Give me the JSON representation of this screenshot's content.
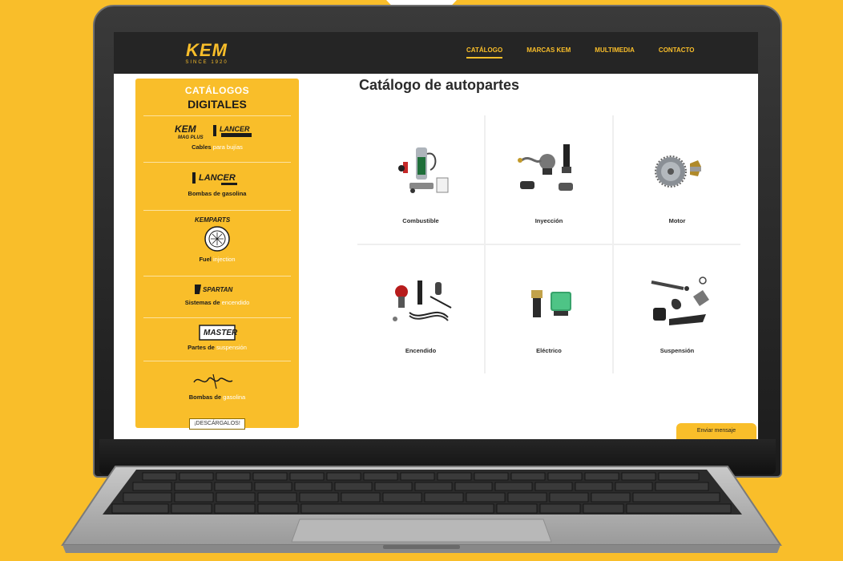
{
  "nav": {
    "logo_word": "KEM",
    "logo_sub": "SINCE 1920",
    "links": [
      {
        "label": "CATÁLOGO"
      },
      {
        "label": "MARCAS KEM"
      },
      {
        "label": "MULTIMEDIA"
      },
      {
        "label": "CONTACTO"
      }
    ]
  },
  "sidebar": {
    "title_line1": "CATÁLOGOS",
    "title_line2": "DIGITALES",
    "items": [
      {
        "brand": "KEM / LANCER",
        "label_bold": "Cables",
        "label_light": "para bujías"
      },
      {
        "brand": "LANCER",
        "label_bold": "Bombas de gasolina",
        "label_light": ""
      },
      {
        "brand": "KEMPARTS",
        "label_bold": "Fuel",
        "label_light": "injection"
      },
      {
        "brand": "SPARTAN",
        "label_bold": "Sistemas de",
        "label_light": "encendido"
      },
      {
        "brand": "MASTER",
        "label_bold": "Partes de",
        "label_light": "suspensión"
      },
      {
        "brand": "waltham",
        "label_bold": "Bombas de",
        "label_light": "gasolina"
      }
    ],
    "download_label": "¡DESCÁRGALOS!"
  },
  "main": {
    "title": "Catálogo de autopartes",
    "categories": [
      {
        "label": "Combustible"
      },
      {
        "label": "Inyección"
      },
      {
        "label": "Motor"
      },
      {
        "label": "Encendido"
      },
      {
        "label": "Eléctrico"
      },
      {
        "label": "Suspensión"
      }
    ],
    "message_button": "Enviar mensaje"
  },
  "colors": {
    "accent": "#F9BE2A",
    "nav_bg": "#252525"
  }
}
